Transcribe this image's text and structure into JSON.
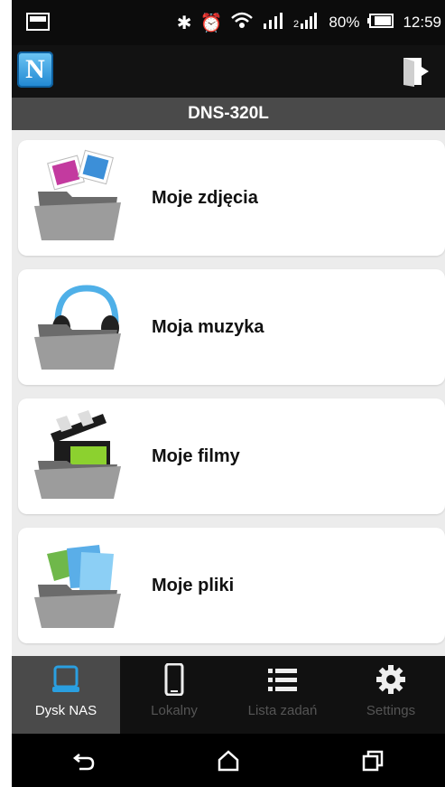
{
  "status": {
    "battery": "80%",
    "time": "12:59",
    "icons": [
      "bluetooth-icon",
      "alarm-icon",
      "wifi-icon",
      "signal-icon",
      "signal2-icon",
      "battery-icon"
    ]
  },
  "appbar": {
    "logo_letter": "N"
  },
  "title": "DNS-320L",
  "menu": [
    {
      "label": "Moje zdjęcia",
      "icon": "photos-folder-icon"
    },
    {
      "label": "Moja muzyka",
      "icon": "music-folder-icon"
    },
    {
      "label": "Moje filmy",
      "icon": "movies-folder-icon"
    },
    {
      "label": "Moje pliki",
      "icon": "files-folder-icon"
    }
  ],
  "tabs": [
    {
      "label": "Dysk NAS",
      "icon": "nas-icon",
      "active": true
    },
    {
      "label": "Lokalny",
      "icon": "phone-icon",
      "active": false
    },
    {
      "label": "Lista zadań",
      "icon": "list-icon",
      "active": false
    },
    {
      "label": "Settings",
      "icon": "gear-icon",
      "active": false
    }
  ],
  "colors": {
    "accent": "#2a9fe0",
    "titlebar": "#4a4a4a"
  }
}
